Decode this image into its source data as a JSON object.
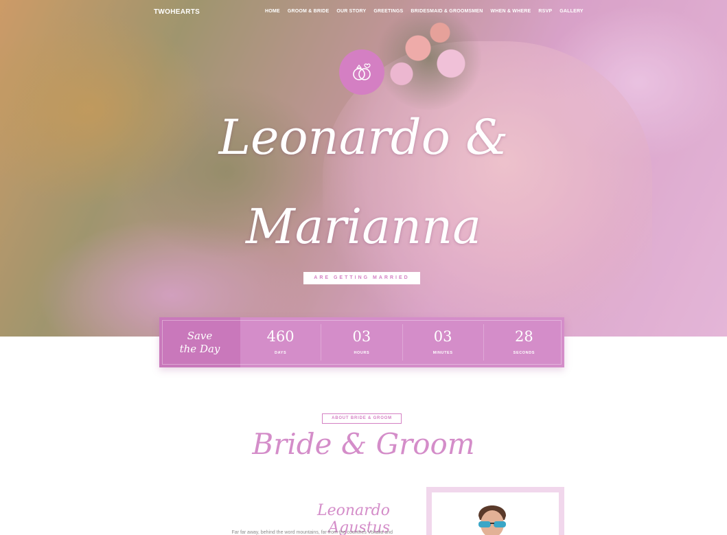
{
  "nav": {
    "brand": "TWOHEARTS",
    "items": [
      "HOME",
      "GROOM & BRIDE",
      "OUR STORY",
      "GREETINGS",
      "BRIDESMAID & GROOMSMEN",
      "WHEN & WHERE",
      "RSVP",
      "GALLERY"
    ]
  },
  "hero": {
    "line1": "Leonardo &",
    "line2": "Marianna",
    "tagline": "ARE GETTING MARRIED"
  },
  "countdown": {
    "save_line1": "Save",
    "save_line2": "the Day",
    "cells": [
      {
        "value": "460",
        "label": "DAYS"
      },
      {
        "value": "03",
        "label": "HOURS"
      },
      {
        "value": "03",
        "label": "MINUTES"
      },
      {
        "value": "28",
        "label": "SECONDS"
      }
    ]
  },
  "about": {
    "tag": "ABOUT BRIDE & GROOM",
    "title": "Bride & Groom",
    "groom_name": "Leonardo Agustus",
    "groom_text": "Far far away, behind the word mountains, far from the countries Vokalia and"
  },
  "colors": {
    "accent": "#d48dc9",
    "accent_dark": "#c978bb",
    "badge": "#d47fc3"
  },
  "icons": {
    "badge": "wedding-rings-icon"
  }
}
